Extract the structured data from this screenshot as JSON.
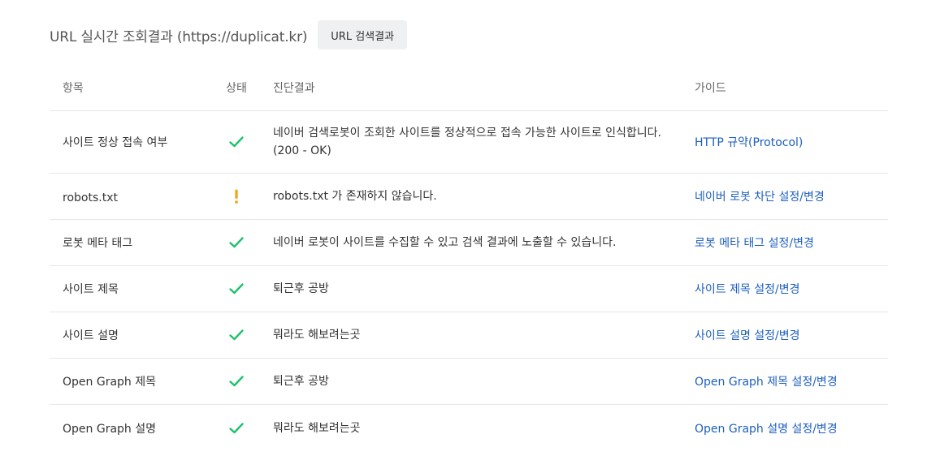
{
  "header": {
    "title": "URL 실시간 조회결과 (https://duplicat.kr)",
    "button_label": "URL 검색결과"
  },
  "table": {
    "columns": [
      "항목",
      "상태",
      "진단결과",
      "가이드"
    ],
    "rows": [
      {
        "item": "사이트 정상 접속 여부",
        "status": "ok",
        "result": "네이버 검색로봇이 조회한 사이트를 정상적으로 접속 가능한 사이트로 인식합니다.\n(200 - OK)",
        "guide": "HTTP 규약(Protocol)"
      },
      {
        "item": "robots.txt",
        "status": "warning",
        "result": "robots.txt 가 존재하지 않습니다.",
        "guide": "네이버 로봇 차단 설정/변경"
      },
      {
        "item": "로봇 메타 태그",
        "status": "ok",
        "result": "네이버 로봇이 사이트를 수집할 수 있고 검색 결과에 노출할 수 있습니다.",
        "guide": "로봇 메타 태그 설정/변경"
      },
      {
        "item": "사이트 제목",
        "status": "ok",
        "result": "퇴근후 공방",
        "guide": "사이트 제목 설정/변경"
      },
      {
        "item": "사이트 설명",
        "status": "ok",
        "result": "뭐라도 해보려는곳",
        "guide": "사이트 설명 설정/변경"
      },
      {
        "item": "Open Graph 제목",
        "status": "ok",
        "result": "퇴근후 공방",
        "guide": "Open Graph 제목 설정/변경"
      },
      {
        "item": "Open Graph 설명",
        "status": "ok",
        "result": "뭐라도 해보려는곳",
        "guide": "Open Graph 설명 설정/변경"
      }
    ]
  },
  "icons": {
    "ok": "check-icon",
    "warning": "exclamation-icon"
  },
  "colors": {
    "ok": "#1ec26a",
    "warning": "#f5a623",
    "link": "#1d5fbf"
  }
}
